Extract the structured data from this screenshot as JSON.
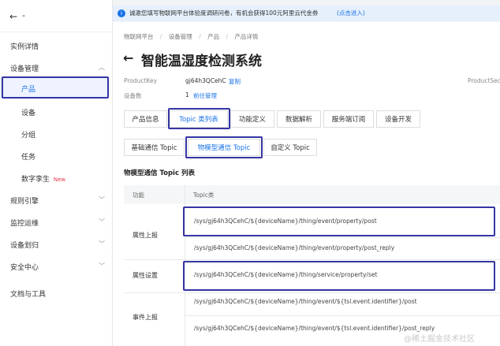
{
  "sidebar": {
    "back": "←",
    "dash": "-",
    "items": [
      {
        "label": "实例详情"
      },
      {
        "label": "设备管理"
      },
      {
        "label": "产品"
      },
      {
        "label": "设备"
      },
      {
        "label": "分组"
      },
      {
        "label": "任务"
      },
      {
        "label": "数字孪生",
        "badge": "New"
      },
      {
        "label": "规则引擎"
      },
      {
        "label": "监控运维"
      },
      {
        "label": "设备划归"
      },
      {
        "label": "安全中心"
      },
      {
        "label": "文档与工具"
      }
    ]
  },
  "notice": {
    "icon": "i",
    "text": "诚邀您填写物联网平台体验度调研问卷，有机会获得100元阿里云代金券",
    "link": "(点击进入)"
  },
  "breadcrumb": [
    "物联网平台",
    "设备管理",
    "产品",
    "产品详情"
  ],
  "page": {
    "title": "智能温湿度检测系统",
    "back": "←"
  },
  "meta": {
    "pk_label": "ProductKey",
    "pk_value": "gj64h3QCehC",
    "copy": "复制",
    "dev_label": "设备数",
    "dev_value": "1",
    "manage": "前往管理",
    "secret_label": "ProductSec"
  },
  "tabs": [
    "产品信息",
    "Topic 类列表",
    "功能定义",
    "数据解析",
    "服务端订阅",
    "设备开发"
  ],
  "subtabs": [
    "基础通信 Topic",
    "物模型通信 Topic",
    "自定义 Topic"
  ],
  "table": {
    "title": "物模型通信 Topic 列表",
    "headers": [
      "功能",
      "Topic类"
    ],
    "rows": [
      {
        "function": "属性上报",
        "topics": [
          "/sys/gj64h3QCehC/${deviceName}/thing/event/property/post",
          "/sys/gj64h3QCehC/${deviceName}/thing/event/property/post_reply"
        ]
      },
      {
        "function": "属性设置",
        "topics": [
          "/sys/gj64h3QCehC/${deviceName}/thing/service/property/set"
        ]
      },
      {
        "function": "事件上报",
        "topics": [
          "/sys/gj64h3QCehC/${deviceName}/thing/event/${tsl.event.identifier}/post",
          "/sys/gj64h3QCehC/${deviceName}/thing/event/${tsl.event.identifier}/post_reply"
        ]
      }
    ]
  },
  "watermark": "@稀土掘金技术社区",
  "colors": {
    "accent": "#1a73e8",
    "highlight": "#3535a4",
    "badge": "#e8374b"
  }
}
